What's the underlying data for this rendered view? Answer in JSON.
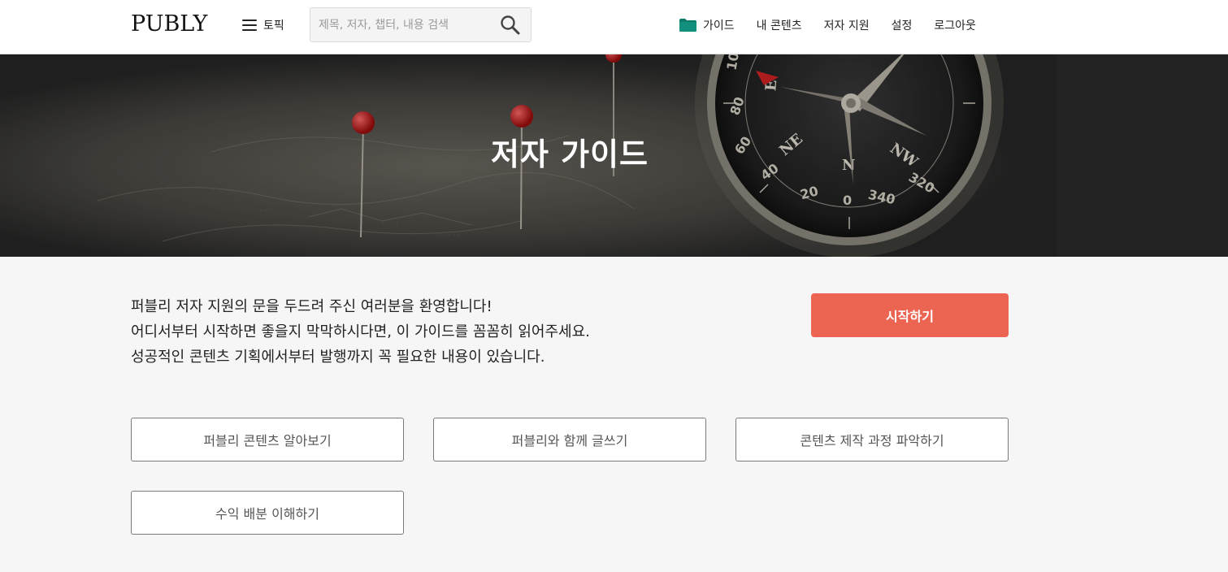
{
  "header": {
    "logo": "PUBLY",
    "topic_label": "토픽",
    "search_placeholder": "제목, 저자, 챕터, 내용 검색",
    "nav": {
      "guide": "가이드",
      "my_contents": "내 콘텐츠",
      "author_support": "저자 지원",
      "settings": "설정",
      "logout": "로그아웃"
    }
  },
  "hero": {
    "title": "저자 가이드"
  },
  "intro": {
    "lines": [
      "퍼블리 저자 지원의 문을 두드려 주신 여러분을 환영합니다!",
      "어디서부터 시작하면 좋을지 막막하시다면, 이 가이드를 꼼꼼히 읽어주세요.",
      "성공적인 콘텐츠 기획에서부터 발행까지 꼭 필요한 내용이 있습니다."
    ],
    "start_button": "시작하기"
  },
  "guide_buttons": [
    "퍼블리 콘텐츠 알아보기",
    "퍼블리와 함께 글쓰기",
    "콘텐츠 제작 과정 파악하기",
    "수익 배분 이해하기"
  ],
  "colors": {
    "accent": "#ec6553",
    "folder": "#0d7a6b",
    "hero_overlay": "#2a2a2a"
  }
}
